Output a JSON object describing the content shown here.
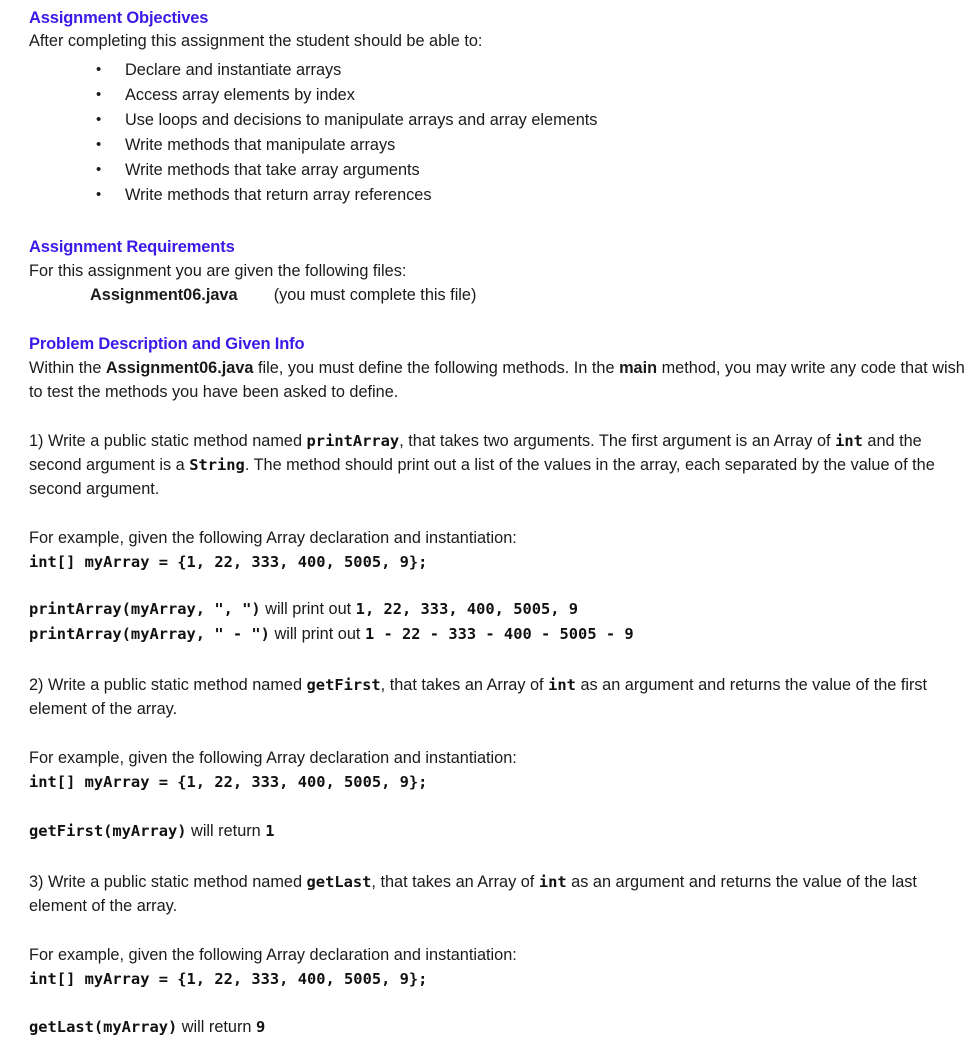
{
  "document": {
    "heading_color": "#3a1ae8",
    "text_color": "#1a1a1a",
    "background_color": "#ffffff"
  },
  "objectives": {
    "heading": "Assignment Objectives",
    "intro": "After completing this assignment the student should be able to:",
    "bullet_glyph": "•",
    "items": [
      "Declare and instantiate arrays",
      "Access array elements by index",
      "Use loops and decisions to manipulate arrays and array elements",
      "Write methods that manipulate arrays",
      "Write methods that take array arguments",
      "Write methods that return array references"
    ]
  },
  "requirements": {
    "heading": "Assignment Requirements",
    "intro": "For this assignment you are given the following files:",
    "file_name": "Assignment06.java",
    "file_note": "(you must complete this file)"
  },
  "problem": {
    "heading": "Problem Description and Given Info",
    "intro_part1": "Within the ",
    "intro_file": "Assignment06.java",
    "intro_part2": " file, you must define the following methods. In the ",
    "intro_main": "main",
    "intro_part3": " method, you may write any code that wish to test the methods you have been asked to define."
  },
  "tasks": [
    {
      "number": "1)",
      "desc_part1": " Write a public static method named ",
      "method_name": "printArray",
      "desc_part2": ", that takes two arguments. The first argument is an Array of ",
      "type_1": "int",
      "desc_part3": " and the second argument is a ",
      "type_2": "String",
      "desc_part4": ". The method should print out a list of the values in the array, each separated by the value of the second argument.",
      "example_intro": "For example, given the following Array declaration and instantiation:",
      "declaration": "int[] myArray = {1, 22, 333, 400, 5005, 9};",
      "calls": [
        {
          "call": "printArray(myArray, \", \")",
          "connector": " will print out ",
          "result": "1, 22, 333, 400, 5005, 9"
        },
        {
          "call": "printArray(myArray, \" - \")",
          "connector": " will print out ",
          "result": "1 - 22 - 333 - 400 - 5005 - 9"
        }
      ]
    },
    {
      "number": "2)",
      "desc_part1": " Write a public static method named ",
      "method_name": "getFirst",
      "desc_part2": ", that takes an Array of ",
      "type_1": "int",
      "desc_part3": " as an argument and returns the value of the first element of the array.",
      "example_intro": "For example, given the following Array declaration and instantiation:",
      "declaration": "int[] myArray = {1, 22, 333, 400, 5005, 9};",
      "calls": [
        {
          "call": "getFirst(myArray)",
          "connector": " will return ",
          "result": "1"
        }
      ]
    },
    {
      "number": "3)",
      "desc_part1": " Write a public static method named ",
      "method_name": "getLast",
      "desc_part2": ", that takes an Array of ",
      "type_1": "int",
      "desc_part3": " as an argument and returns the value of the last element of the array.",
      "example_intro": "For example, given the following Array declaration and instantiation:",
      "declaration": "int[] myArray = {1, 22, 333, 400, 5005, 9};",
      "calls": [
        {
          "call": "getLast(myArray)",
          "connector": " will return ",
          "result": "9"
        }
      ]
    }
  ]
}
